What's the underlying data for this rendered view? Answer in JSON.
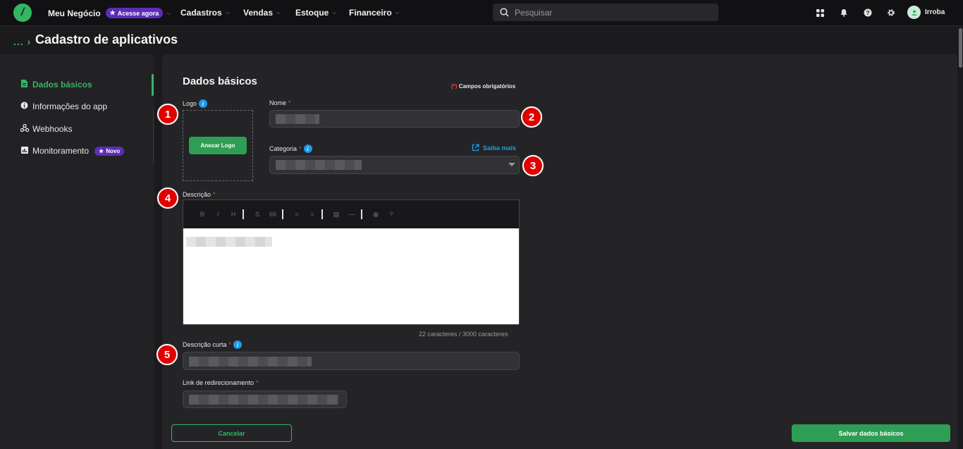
{
  "topbar": {
    "logo_glyph": "/",
    "nav": [
      {
        "label": "Meu Negócio",
        "badge": "Acesse agora"
      },
      {
        "label": "Cadastros"
      },
      {
        "label": "Vendas"
      },
      {
        "label": "Estoque"
      },
      {
        "label": "Financeiro"
      }
    ],
    "search_placeholder": "Pesquisar",
    "user_name": "Irroba"
  },
  "breadcrumb": "...",
  "page_title": "Cadastro de aplicativos",
  "sidebar": {
    "items": [
      {
        "label": "Dados básicos",
        "icon": "file-icon",
        "active": true
      },
      {
        "label": "Informações do app",
        "icon": "info-icon"
      },
      {
        "label": "Webhooks",
        "icon": "webhook-icon"
      },
      {
        "label": "Monitoramento",
        "icon": "chart-icon",
        "badge": "Novo"
      }
    ]
  },
  "form": {
    "section_title": "Dados básicos",
    "required_note_mark": "(*)",
    "required_note": "Campos obrigatórios",
    "logo_label": "Logo",
    "attach_logo_button": "Anexar Logo",
    "name_label": "Nome",
    "category_label": "Categoria",
    "learn_more": "Saiba mais",
    "description_label": "Descrição",
    "char_count": "22 caracteres / 3000 caracteres",
    "short_description_label": "Descrição curta",
    "redirect_link_label": "Link de redirecionamento",
    "required_mark": "*"
  },
  "editor_toolbar": [
    "B",
    "I",
    "H",
    "S",
    "66",
    "≡",
    "≡",
    "▤",
    "—",
    "◉",
    "?"
  ],
  "markers": [
    "1",
    "2",
    "3",
    "4",
    "5"
  ],
  "footer": {
    "cancel_button": "Cancelar",
    "save_button": "Salvar dados básicos"
  },
  "colors": {
    "accent_green": "#33b664",
    "badge_purple": "#5b2db8",
    "info_blue": "#1e9be6",
    "marker_red": "#e00000",
    "required_red": "#e24b4b"
  }
}
